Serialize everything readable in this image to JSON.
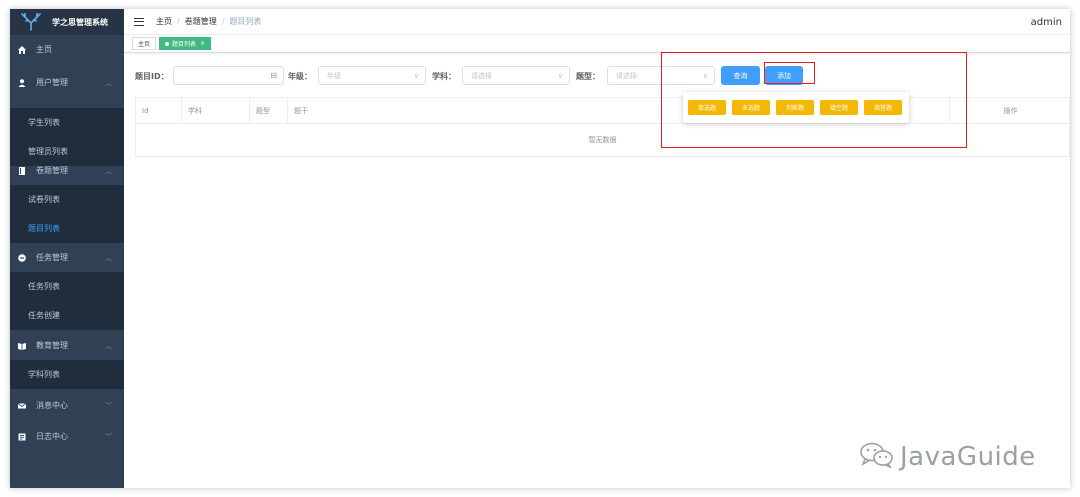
{
  "app": {
    "title": "学之思管理系统"
  },
  "sidebar": {
    "items": [
      {
        "label": "主页",
        "icon": "home-icon"
      },
      {
        "label": "用户管理",
        "icon": "user-icon",
        "children": [
          "学生列表",
          "管理员列表"
        ]
      },
      {
        "label": "卷题管理",
        "icon": "book-icon",
        "children": [
          "试卷列表",
          "题目列表"
        ]
      },
      {
        "label": "任务管理",
        "icon": "task-icon",
        "children": [
          "任务列表",
          "任务创建"
        ]
      },
      {
        "label": "教育管理",
        "icon": "education-icon",
        "children": [
          "学科列表"
        ]
      },
      {
        "label": "消息中心",
        "icon": "mail-icon"
      },
      {
        "label": "日志中心",
        "icon": "log-icon"
      }
    ],
    "active_child": "题目列表",
    "active_color": "#409eff"
  },
  "header": {
    "breadcrumb": [
      "主页",
      "卷题管理",
      "题目列表"
    ],
    "user": "admin"
  },
  "tags": {
    "home": "主页",
    "current": "题目列表"
  },
  "filter": {
    "id_label": "题目ID：",
    "id_value": "",
    "grade_label": "年级：",
    "grade_placeholder": "年级",
    "subject_label": "学科：",
    "subject_placeholder": "请选择",
    "type_label": "题型：",
    "type_placeholder": "请选择",
    "query_button": "查询",
    "add_button": "添加"
  },
  "add_menu": [
    "单选题",
    "多选题",
    "判断题",
    "填空题",
    "简答题"
  ],
  "table": {
    "columns": [
      "Id",
      "学科",
      "题型",
      "题干",
      "操作"
    ],
    "empty_text": "暂无数据"
  },
  "watermark": "JavaGuide",
  "colors": {
    "sidebar": "#304156",
    "primary": "#409eff",
    "warning": "#f5b800",
    "tag_active": "#42b983",
    "annotation": "#e02020"
  }
}
